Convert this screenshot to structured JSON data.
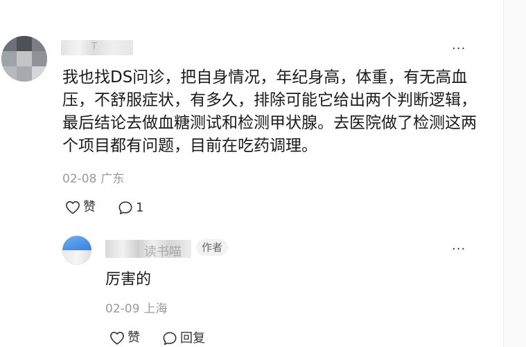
{
  "main_comment": {
    "username": "T",
    "text": "我也找DS问诊，把自身情况，年纪身高，体重，有无高血压，不舒服症状，有多久，排除可能它给出两个判断逻辑，最后结论去做血糖测试和检测甲状腺。去医院做了检测这两个项目都有问题，目前在吃药调理。",
    "date": "02-08",
    "location": "广东",
    "like_label": "赞",
    "reply_count": "1",
    "more_label": "···"
  },
  "reply": {
    "username": "读书喵",
    "author_badge": "作者",
    "text": "厉害的",
    "date": "02-09",
    "location": "上海",
    "like_label": "赞",
    "reply_label": "回复",
    "more_label": "···"
  },
  "icons": {
    "like": "heart-outline-icon",
    "comment": "speech-bubble-icon",
    "more": "ellipsis-icon"
  },
  "colors": {
    "text_primary": "#1a1a1a",
    "text_meta": "#9a9a9a",
    "badge_bg": "#f2f2f2",
    "reply_avatar": "#3f87e0"
  }
}
